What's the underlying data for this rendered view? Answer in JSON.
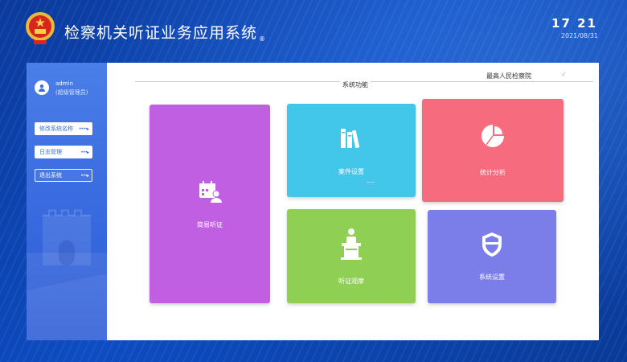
{
  "header": {
    "title": "检察机关听证业务应用系统",
    "title_mark": "®",
    "time": "17  21",
    "date": "2021/08/31"
  },
  "user": {
    "name": "admin",
    "role": "(超级管理员)"
  },
  "sidebar": {
    "items": [
      {
        "label": "修改系统名称",
        "arrow": "••••▸"
      },
      {
        "label": "日志管理",
        "arrow": "•••▸"
      },
      {
        "label": "退出系统",
        "arrow": "•••▸"
      }
    ]
  },
  "main": {
    "court": "最高人民检察院",
    "section_title": "系统功能",
    "tiles": [
      {
        "label": "简易听证",
        "icon": "calendar-user-icon",
        "color": "#c15fe3"
      },
      {
        "label": "案件设置",
        "icon": "books-icon",
        "color": "#42c6ea"
      },
      {
        "label": "统计分析",
        "icon": "pie-chart-icon",
        "color": "#f76b7e"
      },
      {
        "label": "听证观摩",
        "icon": "podium-icon",
        "color": "#8fcf53"
      },
      {
        "label": "系统设置",
        "icon": "shield-icon",
        "color": "#7b7ee8"
      }
    ]
  }
}
